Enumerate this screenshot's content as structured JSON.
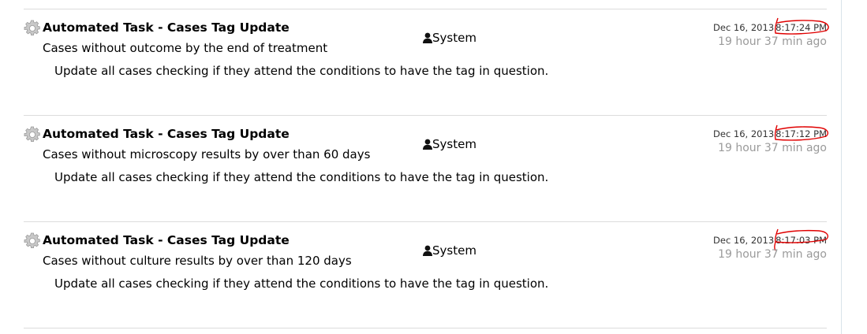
{
  "entries": [
    {
      "title": "Automated Task - Cases Tag Update",
      "subtitle": "Cases without outcome by the end of treatment",
      "description": "Update all cases checking if they attend the conditions to have the tag in question.",
      "user": "System",
      "date": "Dec 16, 2013",
      "time": "8:17:24 PM",
      "ago": "19 hour 37 min ago"
    },
    {
      "title": "Automated Task - Cases Tag Update",
      "subtitle": "Cases without microscopy results by over than 60 days",
      "description": "Update all cases checking if they attend the conditions to have the tag in question.",
      "user": "System",
      "date": "Dec 16, 2013",
      "time": "8:17:12 PM",
      "ago": "19 hour 37 min ago"
    },
    {
      "title": "Automated Task - Cases Tag Update",
      "subtitle": "Cases without culture results by over than 120 days",
      "description": "Update all cases checking if they attend the conditions to have the tag in question.",
      "user": "System",
      "date": "Dec 16, 2013",
      "time": "8:17:03 PM",
      "ago": "19 hour 37 min ago"
    }
  ],
  "colors": {
    "separator": "#dcdcdc",
    "muted": "#9a9a9a",
    "annotation": "#e00000"
  },
  "icons": {
    "entry": "gear-icon",
    "user": "user-icon"
  }
}
